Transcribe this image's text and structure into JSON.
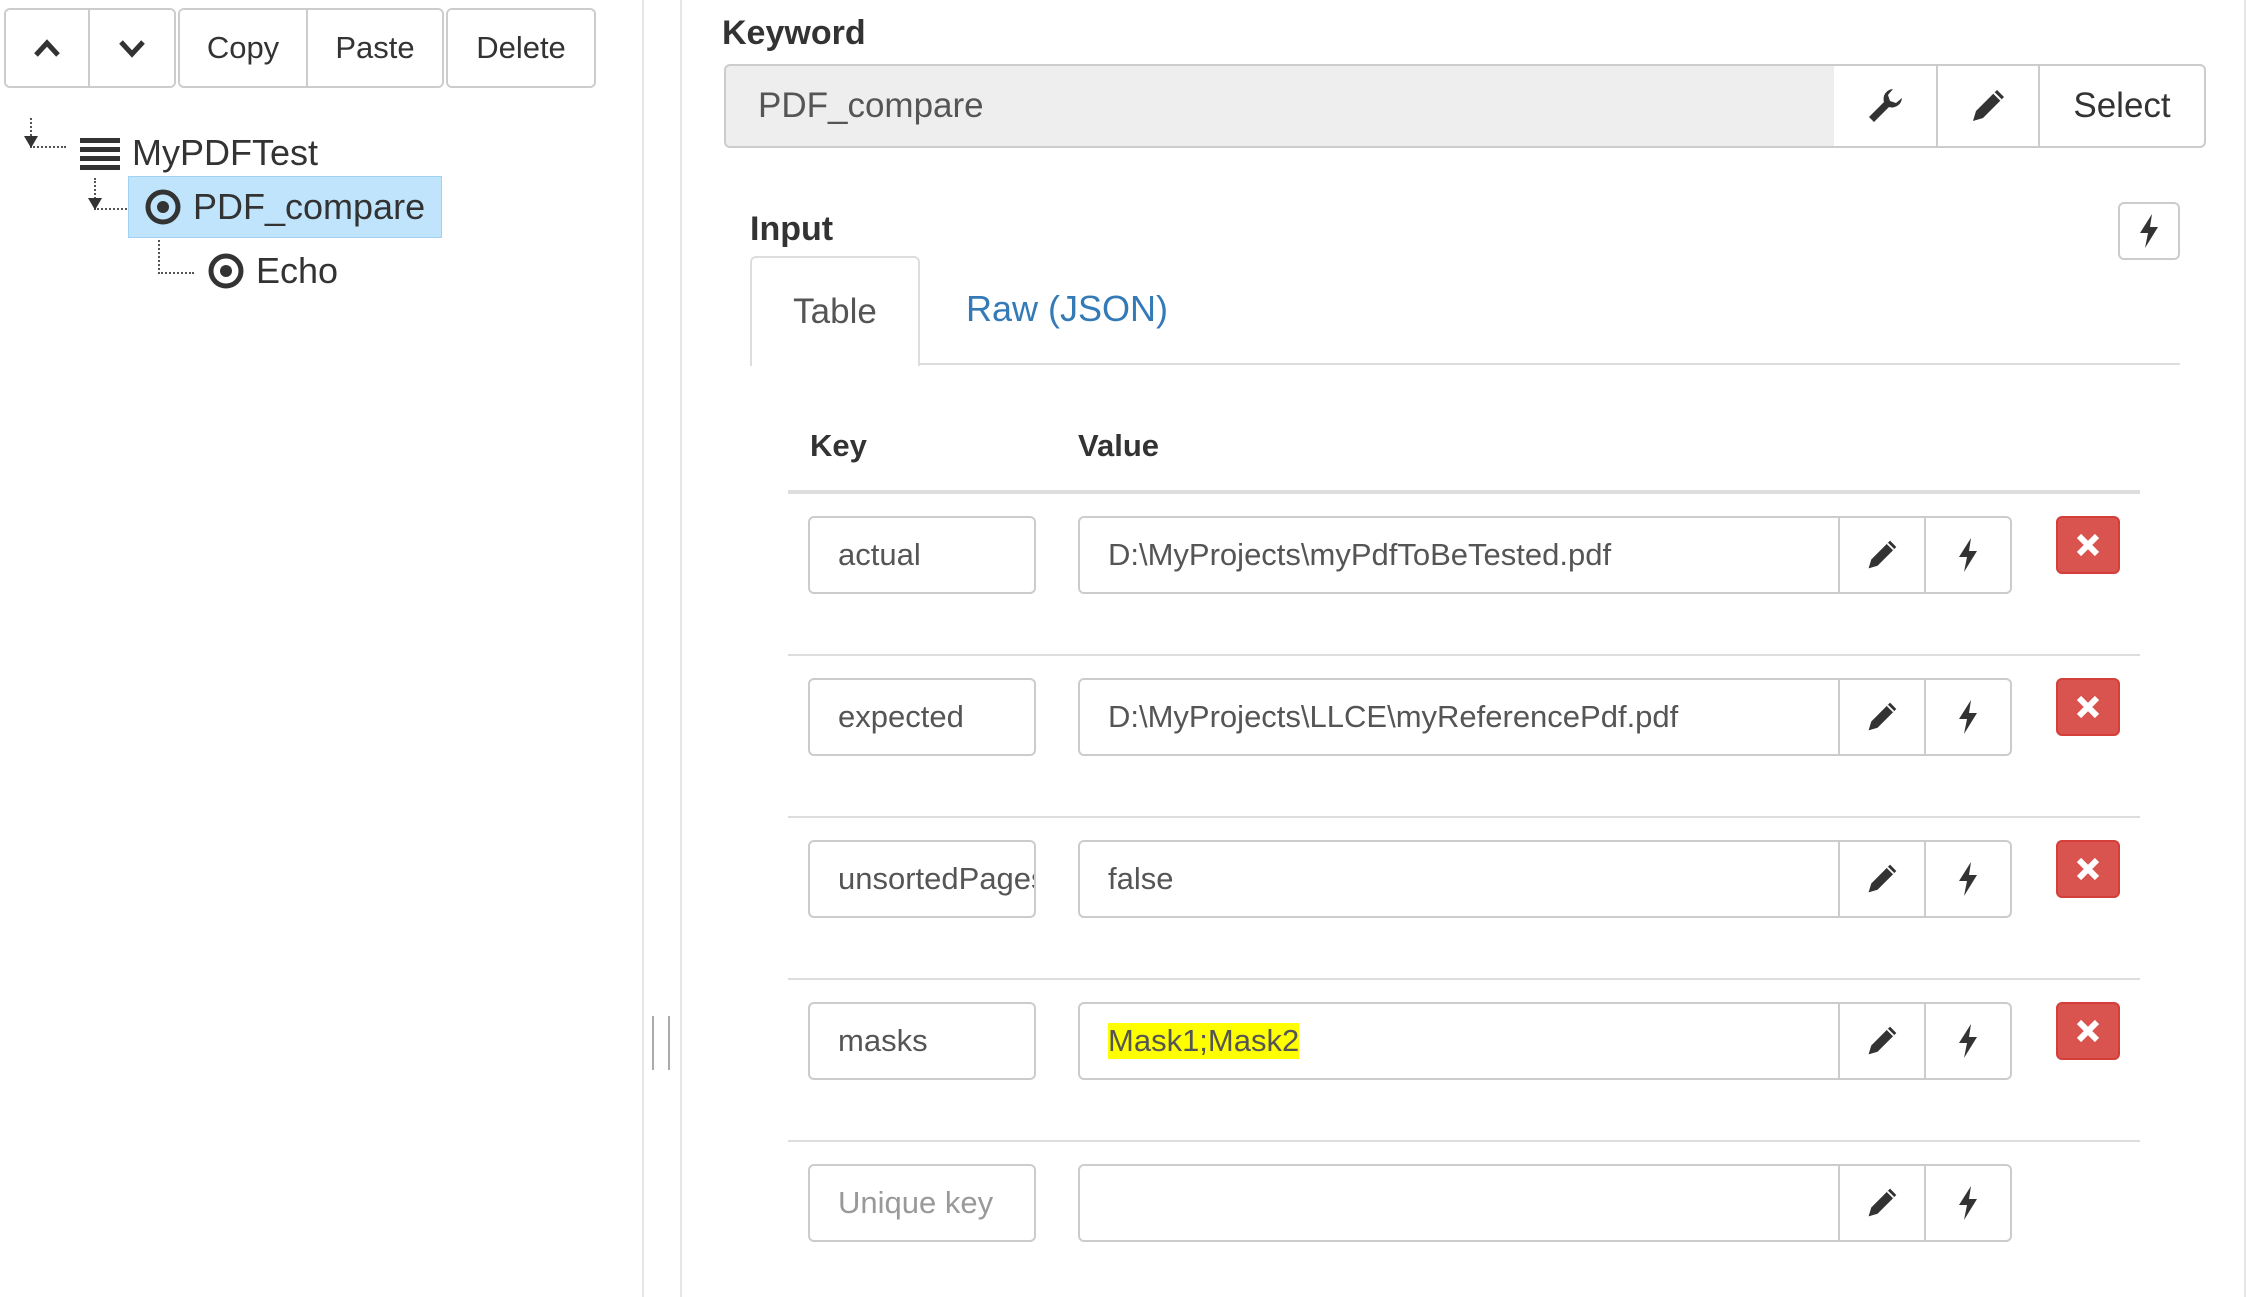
{
  "toolbar": {
    "up_icon": "chevron-up-icon",
    "down_icon": "chevron-down-icon",
    "copy": "Copy",
    "paste": "Paste",
    "delete": "Delete"
  },
  "tree": {
    "root": "MyPDFTest",
    "child": "PDF_compare",
    "grandchild": "Echo"
  },
  "keyword": {
    "heading": "Keyword",
    "value": "PDF_compare",
    "select": "Select"
  },
  "input": {
    "heading": "Input",
    "tabs": [
      "Table",
      "Raw (JSON)"
    ],
    "columns": {
      "key": "Key",
      "value": "Value"
    },
    "rows": [
      {
        "key": "actual",
        "value": "D:\\MyProjects\\myPdfToBeTested.pdf"
      },
      {
        "key": "expected",
        "value": "D:\\MyProjects\\LLCE\\myReferencePdf.pdf"
      },
      {
        "key": "unsortedPages",
        "value": "false"
      },
      {
        "key": "masks",
        "value": "Mask1;Mask2"
      }
    ],
    "new_row": {
      "key_placeholder": "Unique key",
      "value_placeholder": ""
    }
  },
  "colors": {
    "selected_bg": "#bfe4fb",
    "link": "#337ab7",
    "danger": "#d9534f",
    "highlight": "#ffff00"
  }
}
